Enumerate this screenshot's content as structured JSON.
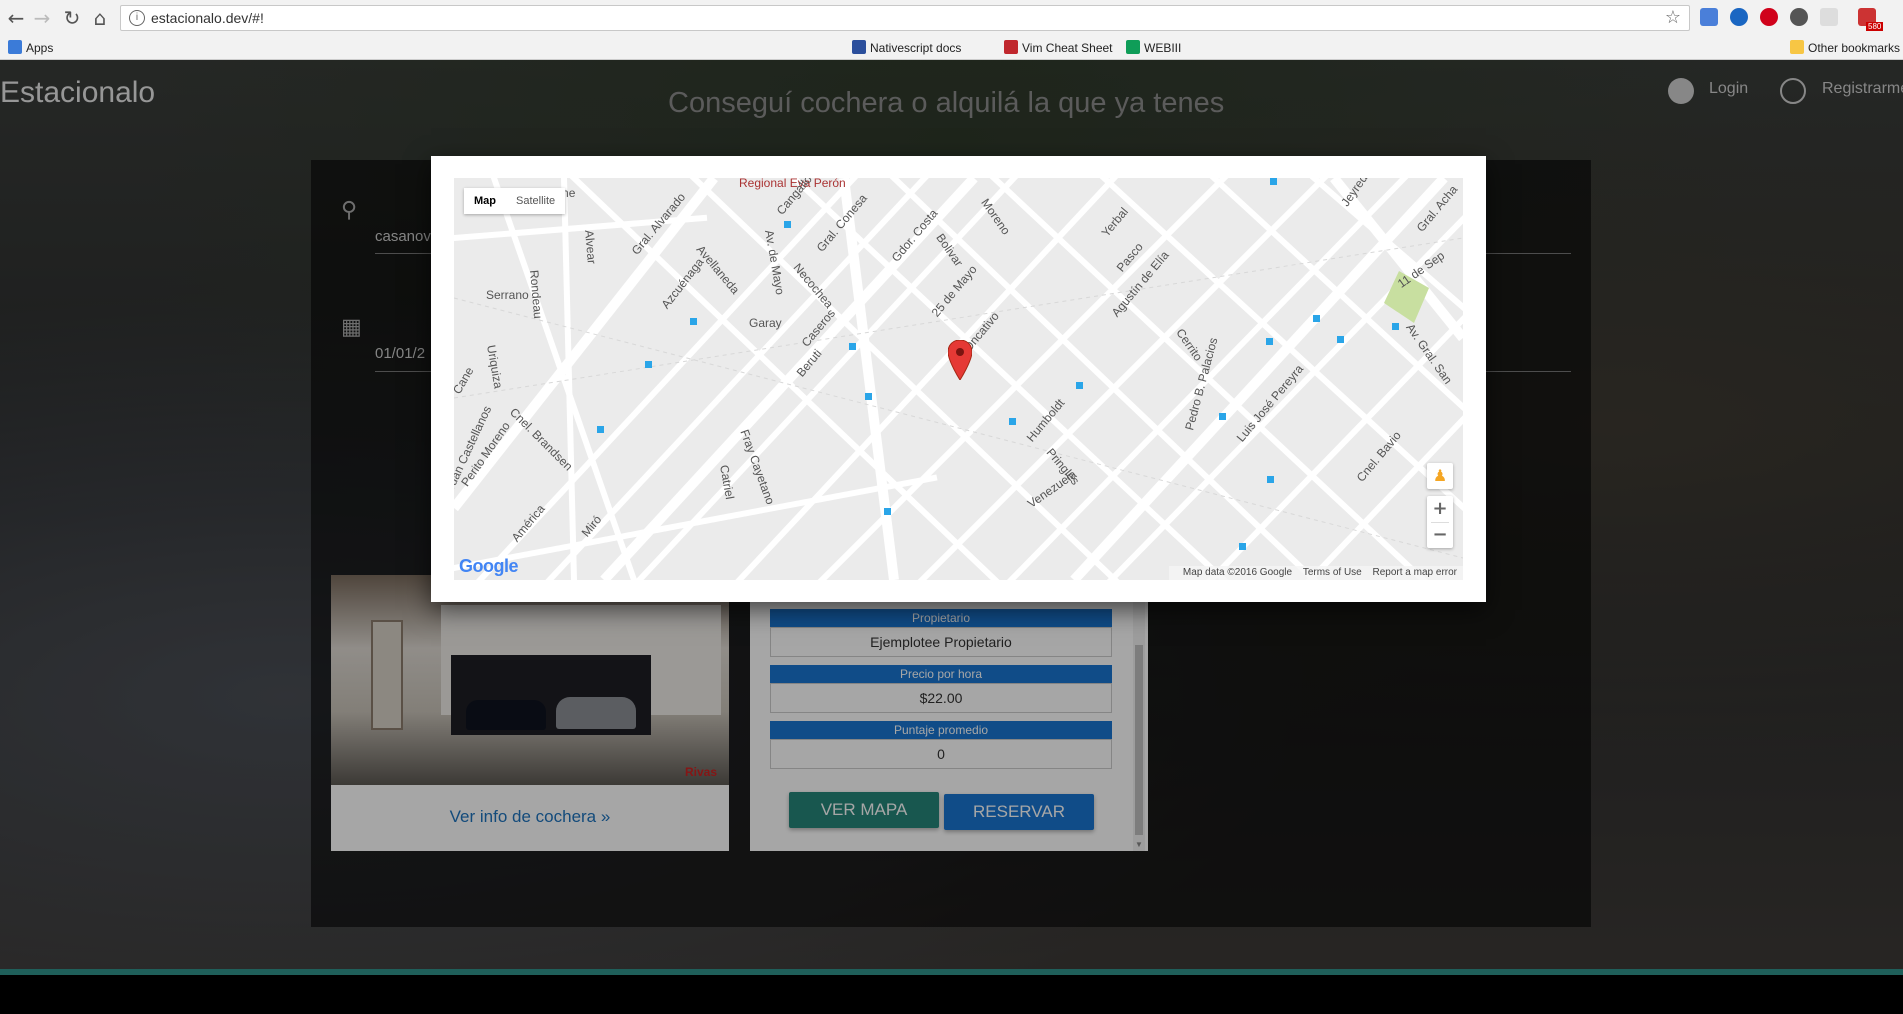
{
  "browser": {
    "url": "estacionalo.dev/#!",
    "bookmarks": {
      "apps": "Apps",
      "nativescript": "Nativescript docs",
      "vim": "Vim Cheat Sheet",
      "webiii": "WEBIII",
      "other": "Other bookmarks"
    },
    "gmail_badge": "580"
  },
  "site": {
    "brand": "Estacionalo",
    "tagline": "Conseguí cochera o alquilá la que ya tenes",
    "login": "Login",
    "register": "Registrarme"
  },
  "search": {
    "location_value": "casanov",
    "date_value": "01/01/2"
  },
  "card": {
    "link": "Ver info de cochera »",
    "watermark": "Rivas"
  },
  "detail": {
    "owner_label": "Propietario",
    "owner_value": "Ejemplotee Propietario",
    "price_label": "Precio por hora",
    "price_value": "$22.00",
    "rating_label": "Puntaje promedio",
    "rating_value": "0",
    "map_button": "VER MAPA",
    "reserve_button": "RESERVAR"
  },
  "map": {
    "type_map": "Map",
    "type_satellite": "Satellite",
    "attribution": "Map data ©2016 Google",
    "terms": "Terms of Use",
    "report": "Report a map error",
    "google_logo": "Google",
    "streets": {
      "s1": "Regional Eva Perón",
      "s2": "Gral. Alvarado",
      "s3": "Azcuénaga",
      "s4": "Avellaneda",
      "s5": "Av. de Mayo",
      "s6": "Cangallo",
      "s7": "Gral. Conesa",
      "s8": "Necochea",
      "s9": "Garay",
      "s10": "Caseros",
      "s11": "Gdor. Costa",
      "s12": "Bolivar",
      "s13": "Moreno",
      "s14": "25 de Mayo",
      "s15": "Oncativo",
      "s16": "Yerbal",
      "s17": "Pasco",
      "s18": "Agustín de Elía",
      "s19": "Cerrito",
      "s20": "Gral. Acha",
      "s21": "Serrano",
      "s22": "Rondeau",
      "s23": "Alvear",
      "s24": "Uriquiza",
      "s25": "Cnel. Brandsen",
      "s26": "Beruti",
      "s27": "Fray Cayetano",
      "s28": "Catriel",
      "s29": "Humboldt",
      "s30": "Venezuela",
      "s31": "Pringles",
      "s32": "Pedro B. Palacios",
      "s33": "Luis José Pereyra",
      "s34": "Av. Gral. San",
      "s35": "Cnel. Bavio",
      "s36": "11 de Sep",
      "s37": "Miró",
      "s38": "América",
      "s39": "Perito Moreno",
      "s40": "Juan Castellanos",
      "s41": "Cane",
      "s42": "Annone",
      "s43": "Jeyredon"
    }
  }
}
